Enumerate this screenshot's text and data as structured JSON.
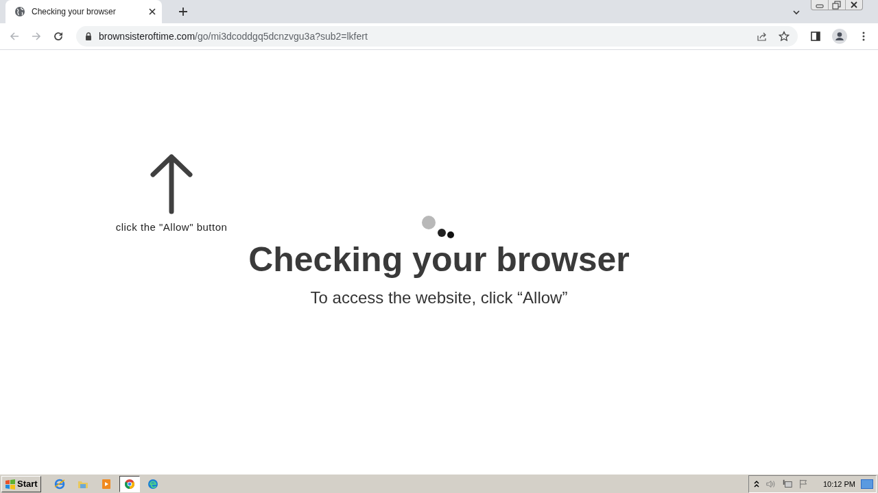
{
  "tab": {
    "title": "Checking your browser",
    "selected": true
  },
  "address_bar": {
    "host": "brownsisteroftime.com",
    "path": "/go/mi3dcoddgq5dcnzvgu3a?sub2=lkfert"
  },
  "page": {
    "hint": "click the \"Allow\" button",
    "heading": "Checking your browser",
    "subtitle": "To access the website, click “Allow”"
  },
  "taskbar": {
    "start": "Start",
    "apps": [
      {
        "kind": "ie",
        "selected": false
      },
      {
        "kind": "folder",
        "selected": false
      },
      {
        "kind": "media",
        "selected": false
      },
      {
        "kind": "chrome",
        "selected": true
      },
      {
        "kind": "edge",
        "selected": false
      }
    ],
    "clock": "10:12 PM"
  }
}
